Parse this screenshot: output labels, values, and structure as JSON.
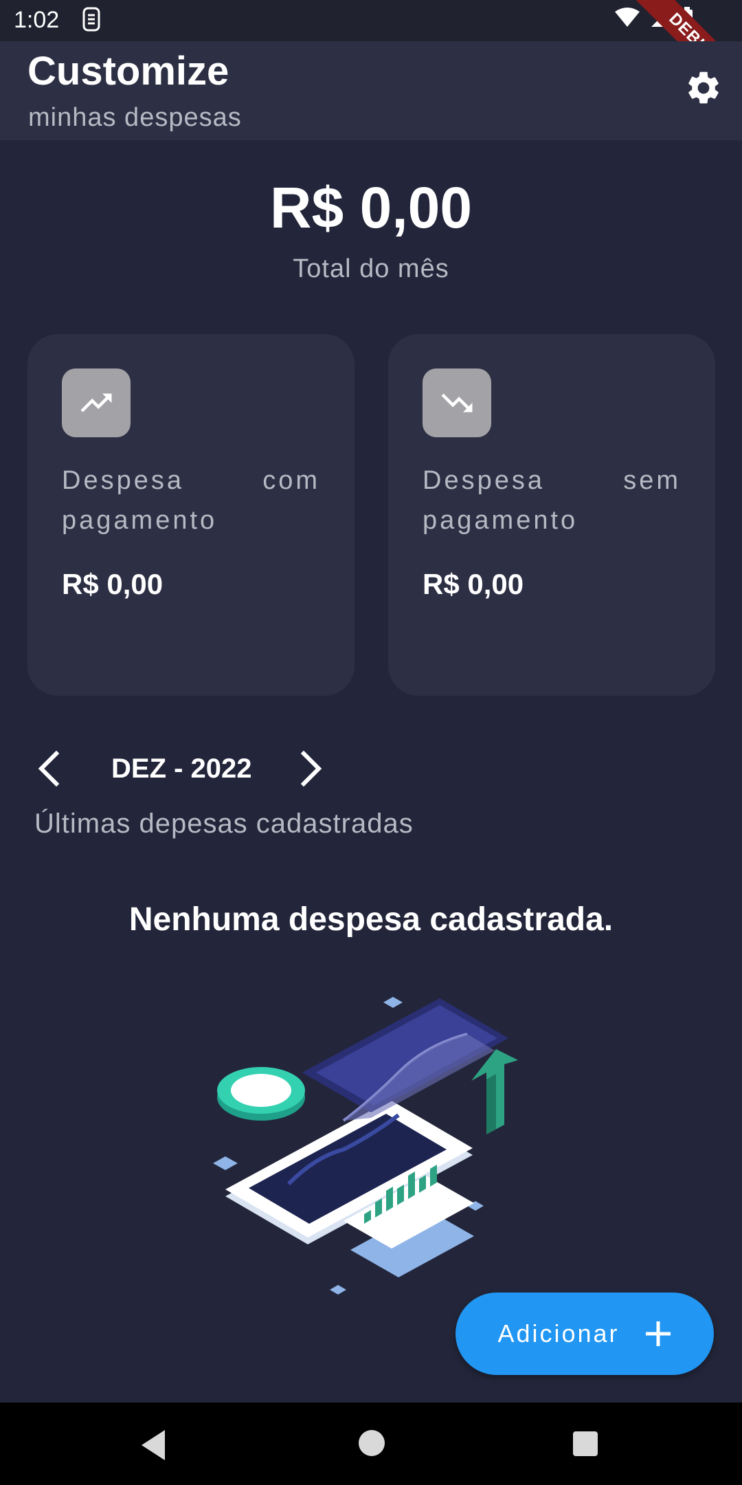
{
  "status_bar": {
    "time": "1:02",
    "debug_label": "DEBUG"
  },
  "app_bar": {
    "title": "Customize",
    "subtitle": "minhas despesas",
    "settings_icon": "gear-icon"
  },
  "summary": {
    "total_amount": "R$ 0,00",
    "total_label": "Total do mês"
  },
  "cards": [
    {
      "label": "Despesa com pagamento",
      "value": "R$ 0,00",
      "icon": "trending-up-icon"
    },
    {
      "label": "Despesa sem pagamento",
      "value": "R$ 0,00",
      "icon": "trending-down-icon"
    }
  ],
  "month_nav": {
    "label": "DEZ - 2022",
    "prev_icon": "chevron-left-icon",
    "next_icon": "chevron-right-icon"
  },
  "recent_label": "Últimas depesas cadastradas",
  "empty_state": {
    "title": "Nenhuma despesa cadastrada."
  },
  "fab": {
    "label": "Adicionar",
    "icon": "plus-icon"
  },
  "colors": {
    "background": "#23263a",
    "surface": "#2d3044",
    "accent": "#2196f3",
    "muted_text": "#b7b9c4"
  }
}
